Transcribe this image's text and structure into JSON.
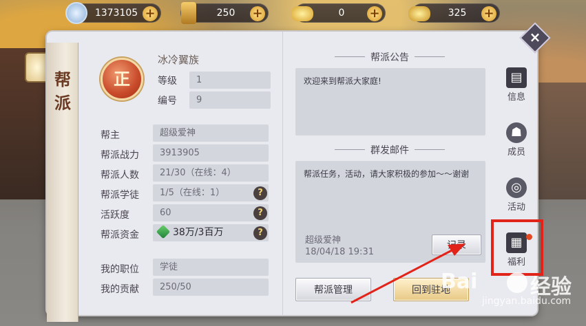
{
  "colors": {
    "accent_red": "#e2231a",
    "gold": "#d89a2a",
    "panel": "#e9eaf0"
  },
  "topbar": {
    "resources": [
      {
        "name": "silver-coin-icon",
        "value": "1373105",
        "plus": "+"
      },
      {
        "name": "scroll-currency-icon",
        "value": "250",
        "plus": "+"
      },
      {
        "name": "gold-ingot-icon",
        "value": "0",
        "plus": "+"
      },
      {
        "name": "bound-gold-icon",
        "value": "325",
        "plus": "+"
      }
    ]
  },
  "tab": {
    "label_1": "帮",
    "label_2": "派"
  },
  "guild": {
    "badge": "正",
    "name": "冰冷翼族",
    "level_label": "等级",
    "level": "1",
    "id_label": "编号",
    "id": "9"
  },
  "info": {
    "leader_label": "帮主",
    "leader": "超级爱神",
    "power_label": "帮派战力",
    "power": "3913905",
    "members_label": "帮派人数",
    "members": "21/30（在线：4）",
    "apprentice_label": "帮派学徒",
    "apprentice": "1/5（在线：1）",
    "activity_label": "活跃度",
    "activity": "60",
    "funds_label": "帮派资金",
    "funds": "38万/3百万",
    "position_label": "我的职位",
    "position": "学徒",
    "contribution_label": "我的贡献",
    "contribution": "250/50",
    "help": "?"
  },
  "notice": {
    "title": "帮派公告",
    "text": "欢迎来到帮派大家庭!"
  },
  "mail": {
    "title": "群发邮件",
    "text": "帮派任务，活动，请大家积极的参加～～谢谢",
    "sender": "超级爱神",
    "date": "18/04/18 19:31",
    "record_button": "记录"
  },
  "buttons": {
    "manage": "帮派管理",
    "return": "回到驻地"
  },
  "side": [
    {
      "label": "信息",
      "icon": "info-book-icon"
    },
    {
      "label": "成员",
      "icon": "member-icon"
    },
    {
      "label": "活动",
      "icon": "activity-icon"
    },
    {
      "label": "福利",
      "icon": "gift-icon"
    }
  ],
  "close": "×",
  "watermark": {
    "brand": "Bai",
    "brand_cn": "经验",
    "url": "jingyan.baidu.com"
  }
}
